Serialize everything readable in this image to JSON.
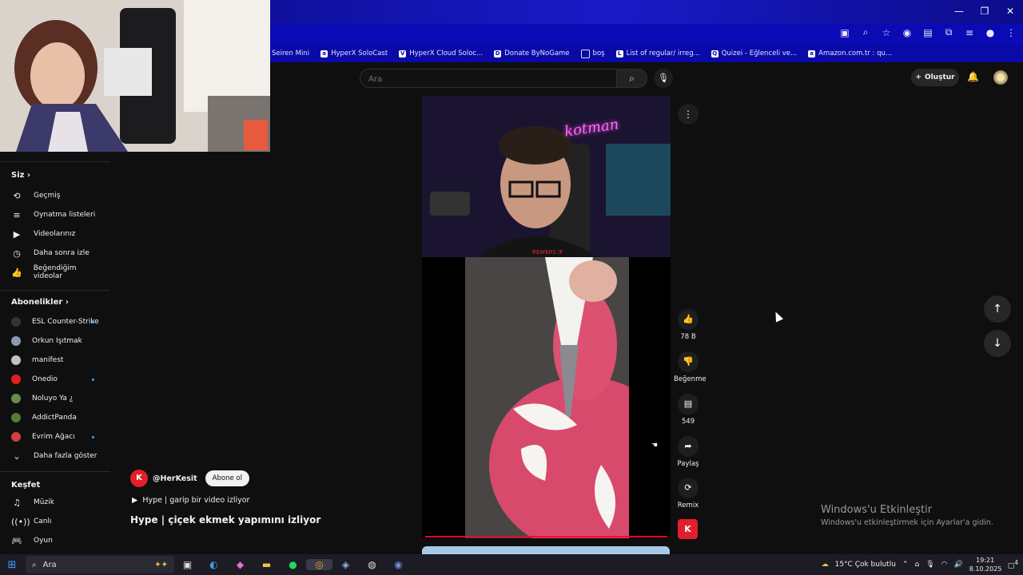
{
  "window": {
    "minimize": "—",
    "restore": "❐",
    "close": "✕"
  },
  "toolbar_icons": [
    "cast-icon",
    "zoom-icon",
    "star-icon",
    "extension-icon",
    "translate-icon",
    "puzzle-icon",
    "media-icon",
    "profile-icon",
    "menu-icon"
  ],
  "bookmarks": [
    {
      "label": "Seiren Mini",
      "icon": ""
    },
    {
      "label": "HyperX SoloCast",
      "icon": "a"
    },
    {
      "label": "HyperX Cloud Soloc...",
      "icon": "V"
    },
    {
      "label": "Donate ByNoGame",
      "icon": "D"
    },
    {
      "label": "boş",
      "icon": "folder"
    },
    {
      "label": "List of regular/ irreg...",
      "icon": "L"
    },
    {
      "label": "Quizei - Eğlenceli ve...",
      "icon": "Q"
    },
    {
      "label": "Amazon.com.tr : qu...",
      "icon": "a"
    }
  ],
  "header": {
    "search_placeholder": "Ara",
    "search_icon": "⌕",
    "mic_icon": "🎙",
    "create_label": "Oluştur",
    "create_icon": "+",
    "bell_icon": "🔔"
  },
  "sidebar": {
    "you_label": "Siz",
    "you_items": [
      {
        "label": "Geçmiş",
        "icon": "⟲"
      },
      {
        "label": "Oynatma listeleri",
        "icon": "≡"
      },
      {
        "label": "Videolarınız",
        "icon": "▶"
      },
      {
        "label": "Daha sonra izle",
        "icon": "◷"
      },
      {
        "label": "Beğendiğim videolar",
        "icon": "👍"
      }
    ],
    "subs_label": "Abonelikler",
    "subs_items": [
      {
        "label": "ESL Counter-Strike",
        "color": "#2a3a2a",
        "live": true
      },
      {
        "label": "Orkun Işıtmak",
        "color": "#8a9bb0",
        "live": false
      },
      {
        "label": "manifest",
        "color": "#c8c0c0",
        "live": false
      },
      {
        "label": "Onedio",
        "color": "#e02020",
        "live": true
      },
      {
        "label": "Noluyo Ya ¿",
        "color": "#6a8a4a",
        "live": false
      },
      {
        "label": "AddictPanda",
        "color": "#5a7a3a",
        "live": false
      },
      {
        "label": "Evrim Ağacı",
        "color": "#d04040",
        "live": true
      }
    ],
    "show_more": "Daha fazla göster",
    "explore_label": "Keşfet",
    "explore_items": [
      {
        "label": "Müzik",
        "icon": "♫"
      },
      {
        "label": "Canlı",
        "icon": "((•))"
      },
      {
        "label": "Oyun",
        "icon": "🎮"
      }
    ]
  },
  "player": {
    "neon_text": "kotman",
    "overlay_text": "REWERS /F"
  },
  "actions": {
    "like_count": "78 B",
    "dislike_label": "Beğenme",
    "comment_count": "549",
    "share_label": "Paylaş",
    "remix_label": "Remix",
    "channel_logo": "K"
  },
  "video": {
    "channel_name": "@HerKesit",
    "channel_avatar": "K",
    "subscribe_label": "Abone ol",
    "playlist_text": "Hype | garip bir video izliyor",
    "title": "Hype | çiçek ekmek yapımını izliyor"
  },
  "activation": {
    "title": "Windows'u Etkinleştir",
    "subtitle": "Windows'u etkinleştirmek için Ayarlar'a gidin."
  },
  "taskbar": {
    "search_label": "Ara",
    "weather": "15°C  Çok bulutlu",
    "time": "19:21",
    "date": "8.10.2025",
    "notification_count": "4"
  }
}
